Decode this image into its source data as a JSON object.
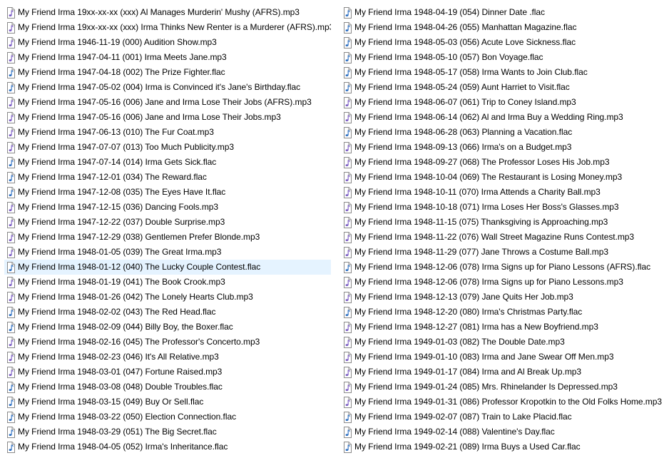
{
  "colors": {
    "selection": "#e5f3ff",
    "mp3_icon_note": "#7a5bc4",
    "flac_icon_note": "#2b6ec2"
  },
  "icons": {
    "mp3": "mp3-audio-file-icon",
    "flac": "flac-audio-file-icon"
  },
  "selected_file": "My Friend Irma 1948-01-12 (040) The Lucky Couple Contest.flac",
  "files_left": [
    {
      "name": "My Friend Irma 19xx-xx-xx (xxx) Al Manages Murderin' Mushy (AFRS).mp3",
      "type": "mp3"
    },
    {
      "name": "My Friend Irma 19xx-xx-xx (xxx) Irma Thinks New Renter is a Murderer (AFRS).mp3",
      "type": "mp3"
    },
    {
      "name": "My Friend Irma 1946-11-19 (000) Audition Show.mp3",
      "type": "mp3"
    },
    {
      "name": "My Friend Irma 1947-04-11 (001) Irma Meets Jane.mp3",
      "type": "mp3"
    },
    {
      "name": "My Friend Irma 1947-04-18 (002) The Prize Fighter.flac",
      "type": "flac"
    },
    {
      "name": "My Friend Irma 1947-05-02 (004) Irma is Convinced it's Jane's Birthday.flac",
      "type": "flac"
    },
    {
      "name": "My Friend Irma 1947-05-16 (006) Jane and Irma Lose Their Jobs (AFRS).mp3",
      "type": "mp3"
    },
    {
      "name": "My Friend Irma 1947-05-16 (006) Jane and Irma Lose Their Jobs.mp3",
      "type": "mp3"
    },
    {
      "name": "My Friend Irma 1947-06-13 (010) The Fur Coat.mp3",
      "type": "mp3"
    },
    {
      "name": "My Friend Irma 1947-07-07 (013) Too Much Publicity.mp3",
      "type": "mp3"
    },
    {
      "name": "My Friend Irma 1947-07-14 (014) Irma Gets Sick.flac",
      "type": "flac"
    },
    {
      "name": "My Friend Irma 1947-12-01 (034) The Reward.flac",
      "type": "flac"
    },
    {
      "name": "My Friend Irma 1947-12-08 (035) The Eyes Have It.flac",
      "type": "flac"
    },
    {
      "name": "My Friend Irma 1947-12-15 (036) Dancing Fools.mp3",
      "type": "mp3"
    },
    {
      "name": "My Friend Irma 1947-12-22 (037) Double Surprise.mp3",
      "type": "mp3"
    },
    {
      "name": "My Friend Irma 1947-12-29 (038) Gentlemen Prefer Blonde.mp3",
      "type": "mp3"
    },
    {
      "name": "My Friend Irma 1948-01-05 (039) The Great Irma.mp3",
      "type": "mp3"
    },
    {
      "name": "My Friend Irma 1948-01-12 (040) The Lucky Couple Contest.flac",
      "type": "flac"
    },
    {
      "name": "My Friend Irma 1948-01-19 (041) The Book Crook.mp3",
      "type": "mp3"
    },
    {
      "name": "My Friend Irma 1948-01-26 (042) The Lonely Hearts Club.mp3",
      "type": "mp3"
    },
    {
      "name": "My Friend Irma 1948-02-02 (043) The Red Head.flac",
      "type": "flac"
    },
    {
      "name": "My Friend Irma 1948-02-09 (044) Billy Boy, the Boxer.flac",
      "type": "flac"
    },
    {
      "name": "My Friend Irma 1948-02-16 (045) The Professor's Concerto.mp3",
      "type": "mp3"
    },
    {
      "name": "My Friend Irma 1948-02-23 (046) It's All Relative.mp3",
      "type": "mp3"
    },
    {
      "name": "My Friend Irma 1948-03-01 (047) Fortune Raised.mp3",
      "type": "mp3"
    },
    {
      "name": "My Friend Irma 1948-03-08 (048) Double Troubles.flac",
      "type": "flac"
    },
    {
      "name": "My Friend Irma 1948-03-15 (049) Buy Or Sell.flac",
      "type": "flac"
    },
    {
      "name": "My Friend Irma 1948-03-22 (050) Election Connection.flac",
      "type": "flac"
    },
    {
      "name": "My Friend Irma 1948-03-29 (051) The Big Secret.flac",
      "type": "flac"
    },
    {
      "name": "My Friend Irma 1948-04-05 (052) Irma's Inheritance.flac",
      "type": "flac"
    }
  ],
  "files_right": [
    {
      "name": "My Friend Irma 1948-04-19 (054) Dinner Date .flac",
      "type": "flac"
    },
    {
      "name": "My Friend Irma 1948-04-26 (055) Manhattan Magazine.flac",
      "type": "flac"
    },
    {
      "name": "My Friend Irma 1948-05-03 (056) Acute Love Sickness.flac",
      "type": "flac"
    },
    {
      "name": "My Friend Irma 1948-05-10 (057) Bon Voyage.flac",
      "type": "flac"
    },
    {
      "name": "My Friend Irma 1948-05-17 (058) Irma Wants to Join Club.flac",
      "type": "flac"
    },
    {
      "name": "My Friend Irma 1948-05-24 (059) Aunt Harriet to Visit.flac",
      "type": "flac"
    },
    {
      "name": "My Friend Irma 1948-06-07 (061) Trip to Coney Island.mp3",
      "type": "mp3"
    },
    {
      "name": "My Friend Irma 1948-06-14 (062) Al and Irma Buy a Wedding Ring.mp3",
      "type": "mp3"
    },
    {
      "name": "My Friend Irma 1948-06-28 (063) Planning a Vacation.flac",
      "type": "flac"
    },
    {
      "name": "My Friend Irma 1948-09-13 (066) Irma's on a Budget.mp3",
      "type": "mp3"
    },
    {
      "name": "My Friend Irma 1948-09-27 (068) The Professor Loses His Job.mp3",
      "type": "mp3"
    },
    {
      "name": "My Friend Irma 1948-10-04 (069) The Restaurant is Losing Money.mp3",
      "type": "mp3"
    },
    {
      "name": "My Friend Irma 1948-10-11 (070) Irma Attends a Charity Ball.mp3",
      "type": "mp3"
    },
    {
      "name": "My Friend Irma 1948-10-18 (071) Irma Loses Her Boss's Glasses.mp3",
      "type": "mp3"
    },
    {
      "name": "My Friend Irma 1948-11-15 (075) Thanksgiving is Approaching.mp3",
      "type": "mp3"
    },
    {
      "name": "My Friend Irma 1948-11-22 (076) Wall Street Magazine Runs Contest.mp3",
      "type": "mp3"
    },
    {
      "name": "My Friend Irma 1948-11-29 (077) Jane Throws a Costume Ball.mp3",
      "type": "mp3"
    },
    {
      "name": "My Friend Irma 1948-12-06 (078) Irma Signs up for Piano Lessons (AFRS).flac",
      "type": "flac"
    },
    {
      "name": "My Friend Irma 1948-12-06 (078) Irma Signs up for Piano Lessons.mp3",
      "type": "mp3"
    },
    {
      "name": "My Friend Irma 1948-12-13 (079) Jane Quits Her Job.mp3",
      "type": "mp3"
    },
    {
      "name": "My Friend Irma 1948-12-20 (080) Irma's Christmas Party.flac",
      "type": "flac"
    },
    {
      "name": "My Friend Irma 1948-12-27 (081) Irma has a New Boyfriend.mp3",
      "type": "mp3"
    },
    {
      "name": "My Friend Irma 1949-01-03 (082) The Double Date.mp3",
      "type": "mp3"
    },
    {
      "name": "My Friend Irma 1949-01-10 (083) Irma and Jane Swear Off Men.mp3",
      "type": "mp3"
    },
    {
      "name": "My Friend Irma 1949-01-17 (084) Irma and Al Break Up.mp3",
      "type": "mp3"
    },
    {
      "name": "My Friend Irma 1949-01-24 (085) Mrs. Rhinelander Is Depressed.mp3",
      "type": "mp3"
    },
    {
      "name": "My Friend Irma 1949-01-31 (086) Professor Kropotkin to the Old Folks Home.mp3",
      "type": "mp3"
    },
    {
      "name": "My Friend Irma 1949-02-07 (087) Train to Lake Placid.flac",
      "type": "flac"
    },
    {
      "name": "My Friend Irma 1949-02-14 (088) Valentine's Day.flac",
      "type": "flac"
    },
    {
      "name": "My Friend Irma 1949-02-21 (089) Irma Buys a Used Car.flac",
      "type": "flac"
    }
  ]
}
